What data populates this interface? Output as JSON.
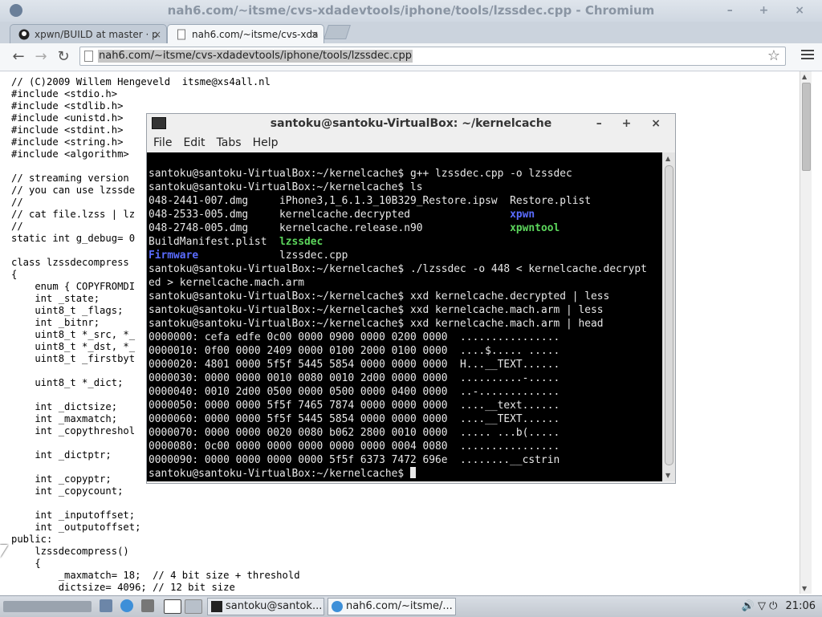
{
  "browser": {
    "window_title": "nah6.com/~itsme/cvs-xdadevtools/iphone/tools/lzssdec.cpp - Chromium",
    "window_controls": "– + ×",
    "tabs": [
      {
        "label": "xpwn/BUILD at master · p",
        "close": "×"
      },
      {
        "label": "nah6.com/~itsme/cvs-xda",
        "close": "×"
      }
    ],
    "nav": {
      "back": "←",
      "forward": "→",
      "reload": "↻"
    },
    "url": "nah6.com/~itsme/cvs-xdadevtools/iphone/tools/lzssdec.cpp",
    "bookmark_icon": "☆"
  },
  "source_lines": [
    "// (C)2009 Willem Hengeveld  itsme@xs4all.nl",
    "#include <stdio.h>",
    "#include <stdlib.h>",
    "#include <unistd.h>",
    "#include <stdint.h>",
    "#include <string.h>",
    "#include <algorithm>",
    "",
    "// streaming version",
    "// you can use lzssde",
    "//",
    "// cat file.lzss | lz",
    "//",
    "static int g_debug= 0",
    "",
    "class lzssdecompress",
    "{",
    "    enum { COPYFROMDI",
    "    int _state;",
    "    uint8_t _flags;",
    "    int _bitnr;",
    "    uint8_t *_src, *_",
    "    uint8_t *_dst, *_",
    "    uint8_t _firstbyt",
    "",
    "    uint8_t *_dict;",
    "",
    "    int _dictsize;",
    "    int _maxmatch;",
    "    int _copythreshol",
    "",
    "    int _dictptr;",
    "",
    "    int _copyptr;",
    "    int _copycount;",
    "",
    "    int _inputoffset;",
    "    int _outputoffset;",
    "public:",
    "    lzssdecompress()",
    "    {",
    "        _maxmatch= 18;  // 4 bit size + threshold",
    "        dictsize= 4096; // 12 bit size"
  ],
  "terminal": {
    "title": "santoku@santoku-VirtualBox: ~/kernelcache",
    "window_controls": "– + ×",
    "menu": [
      "File",
      "Edit",
      "Tabs",
      "Help"
    ],
    "prompt": "santoku@santoku-VirtualBox:~/kernelcache$ ",
    "cmd1": "g++ lzssdec.cpp -o lzssdec",
    "cmd2": "ls",
    "ls": {
      "r1c1": "048-2441-007.dmg     ",
      "r1c2": "iPhone3,1_6.1.3_10B329_Restore.ipsw  ",
      "r1c3": "Restore.plist",
      "r2c1": "048-2533-005.dmg     ",
      "r2c2": "kernelcache.decrypted                ",
      "r2c3": "xpwn",
      "r3c1": "048-2748-005.dmg     ",
      "r3c2": "kernelcache.release.n90              ",
      "r3c3": "xpwntool",
      "r4c1": "BuildManifest.plist  ",
      "r4c2": "lzssdec",
      "r5c1": "Firmware",
      "r5pad": "             ",
      "r5c2": "lzssdec.cpp"
    },
    "cmd3": "./lzssdec -o 448 < kernelcache.decrypt",
    "cmd3_wrap": "ed > kernelcache.mach.arm",
    "cmd4": "xxd kernelcache.decrypted | less",
    "cmd5": "xxd kernelcache.mach.arm | less",
    "cmd6": "xxd kernelcache.mach.arm | head",
    "hexdump": [
      "0000000: cefa edfe 0c00 0000 0900 0000 0200 0000  ................",
      "0000010: 0f00 0000 2409 0000 0100 2000 0100 0000  ....$..... .....",
      "0000020: 4801 0000 5f5f 5445 5854 0000 0000 0000  H...__TEXT......",
      "0000030: 0000 0000 0010 0080 0010 2d00 0000 0000  ..........-.....",
      "0000040: 0010 2d00 0500 0000 0500 0000 0400 0000  ..-.............",
      "0000050: 0000 0000 5f5f 7465 7874 0000 0000 0000  ....__text......",
      "0000060: 0000 0000 5f5f 5445 5854 0000 0000 0000  ....__TEXT......",
      "0000070: 0000 0000 0020 0080 b062 2800 0010 0000  ..... ...b(.....",
      "0000080: 0c00 0000 0000 0000 0000 0000 0004 0080  ................",
      "0000090: 0000 0000 0000 0000 5f5f 6373 7472 696e  ........__cstrin"
    ]
  },
  "taskbar": {
    "task_terminal": "santoku@santok...",
    "task_browser": "nah6.com/~itsme/...",
    "clock": "21:06",
    "tray_icons": "🔊 ▽ ⏻"
  },
  "colors": {
    "dir": "#5a6cff",
    "exe": "#5cd65c"
  }
}
